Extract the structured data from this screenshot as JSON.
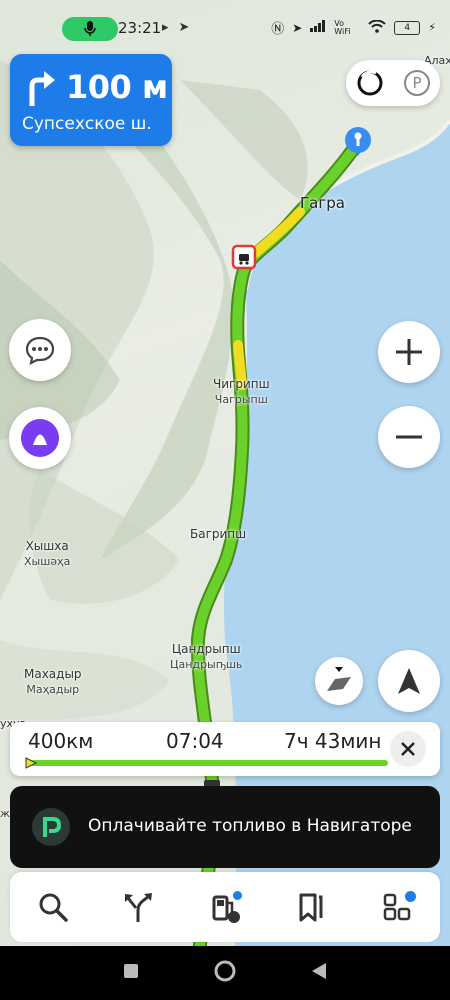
{
  "status_bar": {
    "time": "23:21",
    "battery": "4",
    "network": "Vo WiFi"
  },
  "maneuver": {
    "distance": "100 м",
    "street": "Супсехское ш.",
    "icon": "turn-right-arrow-icon"
  },
  "map": {
    "places": [
      {
        "name": "Гагра",
        "sub": ""
      },
      {
        "name": "Чигрипш",
        "sub": "Чагрыпш"
      },
      {
        "name": "Багрипш",
        "sub": ""
      },
      {
        "name": "Хышха",
        "sub": "Хышәҳа"
      },
      {
        "name": "Цандрыпш",
        "sub": "Цандрыҧшь"
      },
      {
        "name": "Махадыр",
        "sub": "Маҳадыр"
      }
    ],
    "edge_labels": {
      "top_right": "Алах",
      "left_a": "ухуа",
      "left_b": "ж"
    }
  },
  "route_summary": {
    "distance": "400км",
    "arrival": "07:04",
    "duration": "7ч 43мин"
  },
  "banner": {
    "text": "Оплачивайте топливо в Навигаторе"
  },
  "colors": {
    "accent": "#1e7ce8",
    "route_green": "#6ad12a",
    "route_yellow": "#f2dc21",
    "sea": "#aed4f0"
  }
}
